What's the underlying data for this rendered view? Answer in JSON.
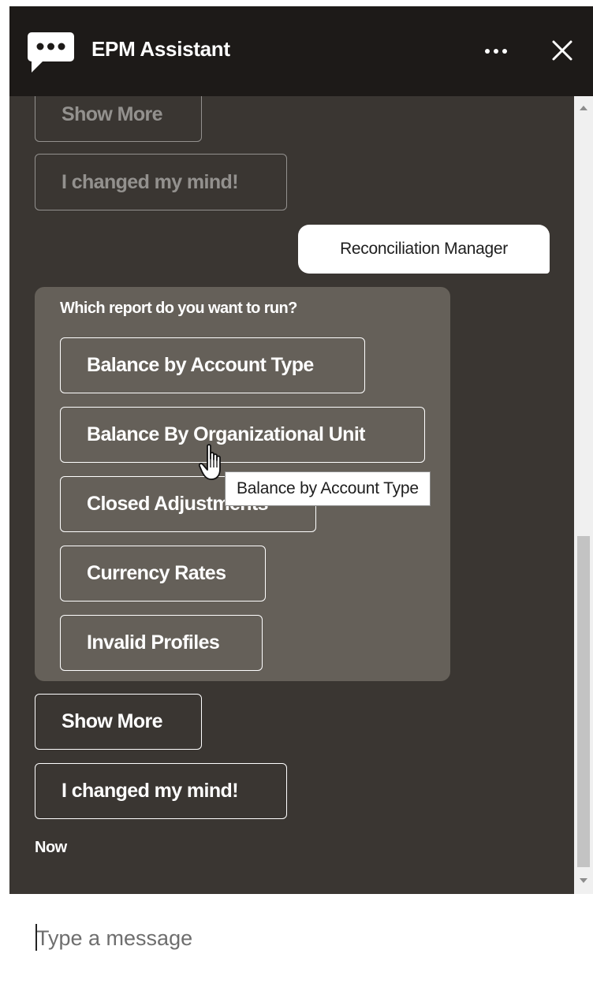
{
  "header": {
    "title": "EPM Assistant",
    "logo_icon": "chat-bubble-icon",
    "more_icon": "more-horizontal-icon",
    "close_icon": "close-icon"
  },
  "conversation": {
    "previous_actions": {
      "show_more": "Show More",
      "changed_mind": "I changed my mind!"
    },
    "user_message": "Reconciliation Manager",
    "bot_message": {
      "question": "Which report do you want to run?",
      "options": [
        "Balance by Account Type",
        "Balance By Organizational Unit",
        "Closed Adjustments",
        "Currency Rates",
        "Invalid Profiles"
      ]
    },
    "actions": {
      "show_more": "Show More",
      "changed_mind": "I changed my mind!"
    },
    "timestamp": "Now"
  },
  "tooltip": {
    "text": "Balance by Account Type"
  },
  "input": {
    "placeholder": "Type a message"
  },
  "colors": {
    "header_bg": "#1d1a18",
    "conversation_bg": "#3a3632",
    "bot_card_bg": "#656059",
    "text": "#ffffff"
  }
}
